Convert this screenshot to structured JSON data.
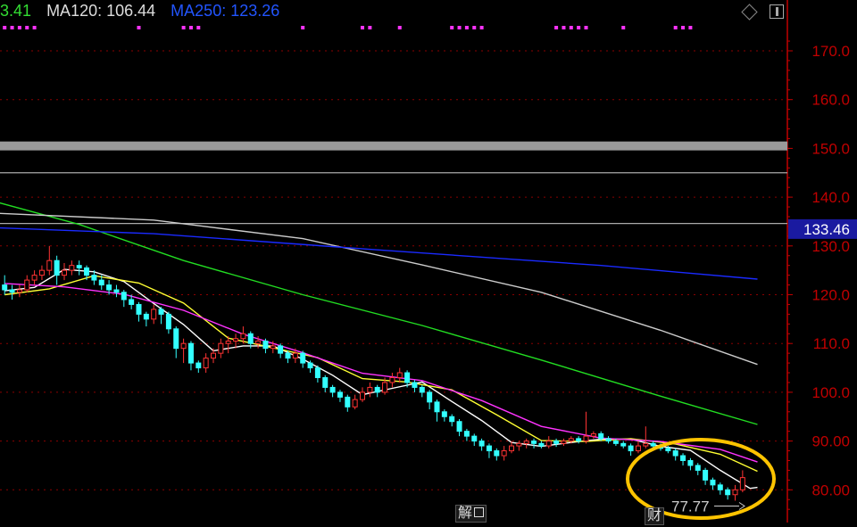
{
  "legend": [
    {
      "label": "3.41",
      "color": "#33dd33"
    },
    {
      "label": "MA120: 106.44",
      "color": "#dddddd"
    },
    {
      "label": "MA250: 123.26",
      "color": "#2255ff"
    }
  ],
  "price_tag": {
    "label": "133.46",
    "value": 133.46,
    "bg": "#1a1aa0"
  },
  "min_annotation": {
    "label": "77.77",
    "value": 77.77
  },
  "markers": [
    {
      "label": "解",
      "name": "unlock-marker"
    },
    {
      "label": "财",
      "name": "earnings-marker"
    }
  ],
  "colors": {
    "up": "#ff3333",
    "down": "#33ffff",
    "grid": "#8b0000",
    "axis": "#c00000",
    "ma_white": "#ffffff",
    "ma_yellow": "#ffff33",
    "ma_magenta": "#ff33ff",
    "ma_green": "#22dd22",
    "ma120": "#cccccc",
    "ma250": "#1a2aff",
    "signal": "#ff33ff",
    "highlight": "#ffc400"
  },
  "chart_data": {
    "type": "candlestick",
    "ylim": [
      75,
      180
    ],
    "y_ticks": [
      "170.0",
      "160.0",
      "150.0",
      "140.0",
      "130.0",
      "120.0",
      "110.0",
      "100.0",
      "90.00",
      "80.00"
    ],
    "grid": true,
    "horizontal_levels": [
      {
        "value": 150.5,
        "kind": "band"
      },
      {
        "value": 145.0,
        "kind": "line"
      },
      {
        "value": 134.6,
        "kind": "line"
      }
    ],
    "candles": [
      [
        122,
        121,
        124,
        120
      ],
      [
        121,
        120.5,
        122,
        119
      ],
      [
        120.5,
        121,
        122,
        119.5
      ],
      [
        121,
        123,
        124,
        120.5
      ],
      [
        123,
        124,
        125,
        122
      ],
      [
        124,
        125,
        126,
        123
      ],
      [
        125,
        127,
        130,
        124
      ],
      [
        127,
        124,
        128,
        122
      ],
      [
        124,
        125,
        126.5,
        123
      ],
      [
        125,
        126,
        127,
        124
      ],
      [
        126,
        125.5,
        127,
        124
      ],
      [
        125.5,
        124,
        126,
        123
      ],
      [
        124,
        123,
        125,
        122
      ],
      [
        123,
        122,
        124,
        121
      ],
      [
        122,
        121,
        123,
        120
      ],
      [
        121,
        120.5,
        122,
        119.5
      ],
      [
        120.5,
        119,
        121,
        117.5
      ],
      [
        119,
        118,
        120,
        117
      ],
      [
        118,
        116,
        118.5,
        114.5
      ],
      [
        116,
        115,
        116.5,
        113.5
      ],
      [
        115,
        117,
        118,
        114
      ],
      [
        117,
        116,
        117.5,
        114
      ],
      [
        116,
        113,
        116.5,
        112
      ],
      [
        113,
        109,
        113.5,
        107
      ],
      [
        109,
        110,
        111,
        106
      ],
      [
        110,
        106,
        110.5,
        104.5
      ],
      [
        106,
        105,
        106.5,
        104
      ],
      [
        105,
        107,
        108,
        104
      ],
      [
        107,
        108,
        109,
        106
      ],
      [
        108,
        110,
        111,
        107
      ],
      [
        110,
        110.5,
        111.5,
        108
      ],
      [
        110.5,
        111,
        112,
        109
      ],
      [
        111,
        112,
        113.5,
        110
      ],
      [
        112,
        110,
        112.5,
        109
      ],
      [
        110,
        110.5,
        111.5,
        109
      ],
      [
        110.5,
        109,
        111,
        108
      ],
      [
        109,
        109.5,
        110.5,
        108
      ],
      [
        109.5,
        108,
        110,
        107
      ],
      [
        108,
        107,
        108.5,
        106
      ],
      [
        107,
        108,
        109,
        106
      ],
      [
        108,
        106,
        108.5,
        105
      ],
      [
        106,
        105,
        106.5,
        104
      ],
      [
        105,
        103,
        105.5,
        102
      ],
      [
        103,
        101,
        103.5,
        100
      ],
      [
        101,
        100,
        101.5,
        99
      ],
      [
        100,
        99,
        100.5,
        98
      ],
      [
        99,
        97,
        99.5,
        96
      ],
      [
        97,
        98.5,
        99.5,
        96.5
      ],
      [
        98.5,
        100,
        101,
        98
      ],
      [
        100,
        101,
        102,
        99
      ],
      [
        101,
        100,
        101.5,
        99
      ],
      [
        100,
        102,
        103,
        99.5
      ],
      [
        102,
        103,
        104,
        101
      ],
      [
        103,
        104,
        105,
        102
      ],
      [
        104,
        102,
        104.5,
        101
      ],
      [
        102,
        101,
        102.5,
        100
      ],
      [
        101,
        100,
        101.5,
        99
      ],
      [
        100,
        98,
        100.5,
        96.5
      ],
      [
        98,
        96,
        98.5,
        94
      ],
      [
        96,
        95,
        96.5,
        94
      ],
      [
        95,
        94,
        95.5,
        93
      ],
      [
        94,
        92,
        94.5,
        91
      ],
      [
        92,
        91,
        92.5,
        90
      ],
      [
        91,
        90,
        91.5,
        89
      ],
      [
        90,
        89,
        90.5,
        88
      ],
      [
        89,
        88,
        89.5,
        86.5
      ],
      [
        88,
        87,
        88.5,
        86
      ],
      [
        87,
        88,
        89,
        86
      ],
      [
        88,
        89,
        90,
        87.5
      ],
      [
        89,
        89.5,
        90,
        88
      ],
      [
        89.5,
        90,
        90.5,
        88.5
      ],
      [
        90,
        89.5,
        90.5,
        88.5
      ],
      [
        89.5,
        89,
        90,
        88.5
      ],
      [
        89,
        90,
        91,
        88.5
      ],
      [
        90,
        89.5,
        90.5,
        88.8
      ],
      [
        89.5,
        90,
        90.5,
        89
      ],
      [
        90,
        90.5,
        91,
        89.5
      ],
      [
        90.5,
        90,
        91,
        89.5
      ],
      [
        90,
        91,
        96,
        89.5
      ],
      [
        91,
        91.5,
        92,
        90.5
      ],
      [
        91.5,
        90.5,
        92,
        90
      ],
      [
        90.5,
        90,
        91,
        89.5
      ],
      [
        90,
        89.5,
        90.5,
        89
      ],
      [
        89.5,
        89,
        90,
        88.5
      ],
      [
        89,
        88,
        89.5,
        87
      ],
      [
        88,
        89,
        90,
        87.5
      ],
      [
        89,
        89.5,
        93,
        88.5
      ],
      [
        89.5,
        89,
        90,
        88.5
      ],
      [
        89,
        88.5,
        89.5,
        88
      ],
      [
        88.5,
        88,
        89,
        87.5
      ],
      [
        88,
        87,
        88.5,
        86
      ],
      [
        87,
        86,
        87.5,
        85
      ],
      [
        86,
        85,
        86.5,
        84
      ],
      [
        85,
        84,
        85.5,
        83
      ],
      [
        84,
        82,
        84.5,
        81
      ],
      [
        82,
        81,
        82.5,
        80
      ],
      [
        81,
        80,
        81.5,
        79
      ],
      [
        80,
        79,
        80.5,
        78
      ],
      [
        79,
        80,
        81,
        77.77
      ],
      [
        80,
        82.5,
        84,
        79.5
      ]
    ],
    "ma_series": [
      {
        "color": "#ffffff",
        "points": [
          [
            0,
            120.8
          ],
          [
            4,
            121.5
          ],
          [
            8,
            125.2
          ],
          [
            12,
            124.7
          ],
          [
            16,
            122.7
          ],
          [
            20,
            118.2
          ],
          [
            24,
            113.9
          ],
          [
            28,
            108.5
          ],
          [
            32,
            109.5
          ],
          [
            36,
            109.5
          ],
          [
            40,
            106.8
          ],
          [
            44,
            103.5
          ],
          [
            48,
            99.5
          ],
          [
            52,
            100.8
          ],
          [
            56,
            102.1
          ],
          [
            60,
            98.1
          ],
          [
            64,
            94.2
          ],
          [
            68,
            89.7
          ],
          [
            72,
            88.9
          ],
          [
            76,
            89.7
          ],
          [
            80,
            90.4
          ],
          [
            84,
            90.4
          ],
          [
            88,
            88.9
          ],
          [
            92,
            88.1
          ],
          [
            96,
            84.0
          ],
          [
            100,
            80.3
          ],
          [
            101,
            80.5
          ]
        ]
      },
      {
        "color": "#ffff33",
        "points": [
          [
            0,
            120.0
          ],
          [
            6,
            121.2
          ],
          [
            12,
            123.9
          ],
          [
            18,
            122.4
          ],
          [
            24,
            118.3
          ],
          [
            30,
            111.1
          ],
          [
            36,
            109.1
          ],
          [
            42,
            107.1
          ],
          [
            48,
            102.8
          ],
          [
            54,
            102.1
          ],
          [
            60,
            100.5
          ],
          [
            66,
            95.4
          ],
          [
            72,
            90.1
          ],
          [
            78,
            89.9
          ],
          [
            84,
            90.5
          ],
          [
            90,
            89.4
          ],
          [
            96,
            87.3
          ],
          [
            101,
            83.8
          ]
        ]
      },
      {
        "color": "#ff33ff",
        "points": [
          [
            0,
            122.3
          ],
          [
            8,
            121.6
          ],
          [
            16,
            120.1
          ],
          [
            24,
            116.8
          ],
          [
            32,
            111.9
          ],
          [
            40,
            108.1
          ],
          [
            48,
            103.9
          ],
          [
            56,
            102.4
          ],
          [
            64,
            98.3
          ],
          [
            72,
            93.0
          ],
          [
            80,
            90.6
          ],
          [
            88,
            89.9
          ],
          [
            96,
            88.3
          ],
          [
            101,
            85.7
          ]
        ]
      },
      {
        "color": "#22dd22",
        "points": [
          [
            -4,
            140.2
          ],
          [
            10,
            134.4
          ],
          [
            24,
            127.0
          ],
          [
            40,
            120.0
          ],
          [
            56,
            113.7
          ],
          [
            72,
            106.6
          ],
          [
            88,
            99.2
          ],
          [
            101,
            93.4
          ]
        ]
      },
      {
        "color": "#cccccc",
        "points": [
          [
            -4,
            136.9
          ],
          [
            20,
            135.3
          ],
          [
            40,
            131.5
          ],
          [
            56,
            126.1
          ],
          [
            72,
            120.5
          ],
          [
            88,
            112.7
          ],
          [
            101,
            105.7
          ]
        ]
      },
      {
        "color": "#1a2aff",
        "points": [
          [
            -4,
            133.9
          ],
          [
            20,
            132.5
          ],
          [
            50,
            129.2
          ],
          [
            80,
            126.0
          ],
          [
            101,
            123.2
          ]
        ]
      }
    ],
    "signal_dot_index_groups": [
      [
        0,
        4
      ],
      [
        18
      ],
      [
        24,
        26
      ],
      [
        40
      ],
      [
        48,
        49
      ],
      [
        53
      ],
      [
        60,
        62,
        64
      ],
      [
        74,
        76,
        78
      ],
      [
        83
      ],
      [
        90,
        92
      ]
    ]
  }
}
